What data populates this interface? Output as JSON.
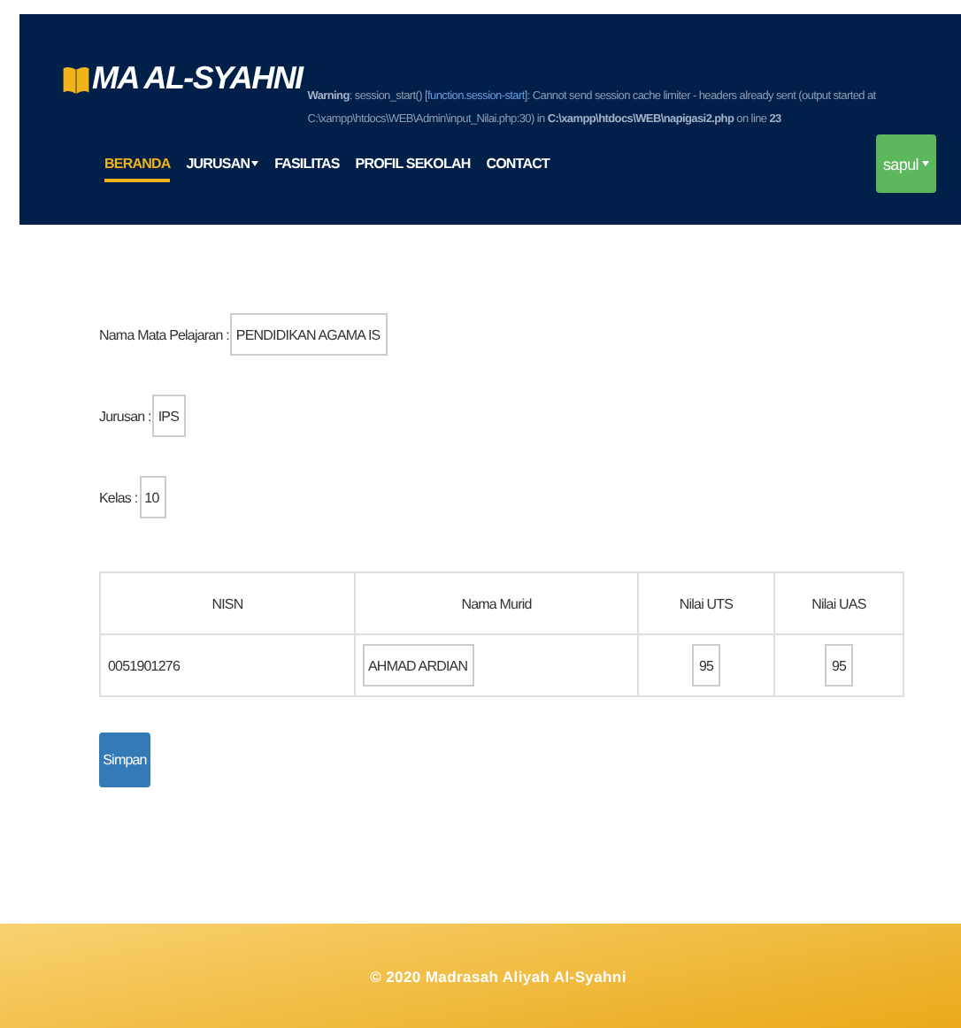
{
  "header": {
    "brand": "MA AL-SYAHNI",
    "warning": {
      "before": "**Warning**: session_start() [",
      "link": "function.session-start",
      "after": "]: Cannot send session cache limiter - headers already sent (output started at C:\\xampp\\htdocs\\WEB\\Admin\\input_Nilai.php:30) in **C:\\xampp\\htdocs\\WEB\\napigasi2.php** on line **23**"
    },
    "nav": [
      {
        "label": "BERANDA",
        "selected": true,
        "dropdown": false
      },
      {
        "label": "JURUSAN",
        "selected": false,
        "dropdown": true
      },
      {
        "label": "FASILITAS",
        "selected": false,
        "dropdown": false
      },
      {
        "label": "PROFIL SEKOLAH",
        "selected": false,
        "dropdown": false
      },
      {
        "label": "CONTACT",
        "selected": false,
        "dropdown": false
      }
    ],
    "user_button": "sapul"
  },
  "form": {
    "fields": [
      {
        "label": "Nama Mata Pelajaran :",
        "value": "PENDIDIKAN AGAMA IS"
      },
      {
        "label": "Jurusan :",
        "value": "IPS"
      },
      {
        "label": "Kelas :",
        "value": "10"
      }
    ],
    "table": {
      "columns": [
        "NISN",
        "Nama Murid",
        "Nilai UTS",
        "Nilai UAS"
      ],
      "rows": [
        {
          "nisn": "0051901276",
          "name": "AHMAD ARDIAN",
          "uts": "95",
          "uas": "95"
        }
      ]
    },
    "submit": "Simpan"
  },
  "footer": "© 2020 Madrasah Aliyah Al-Syahni"
}
